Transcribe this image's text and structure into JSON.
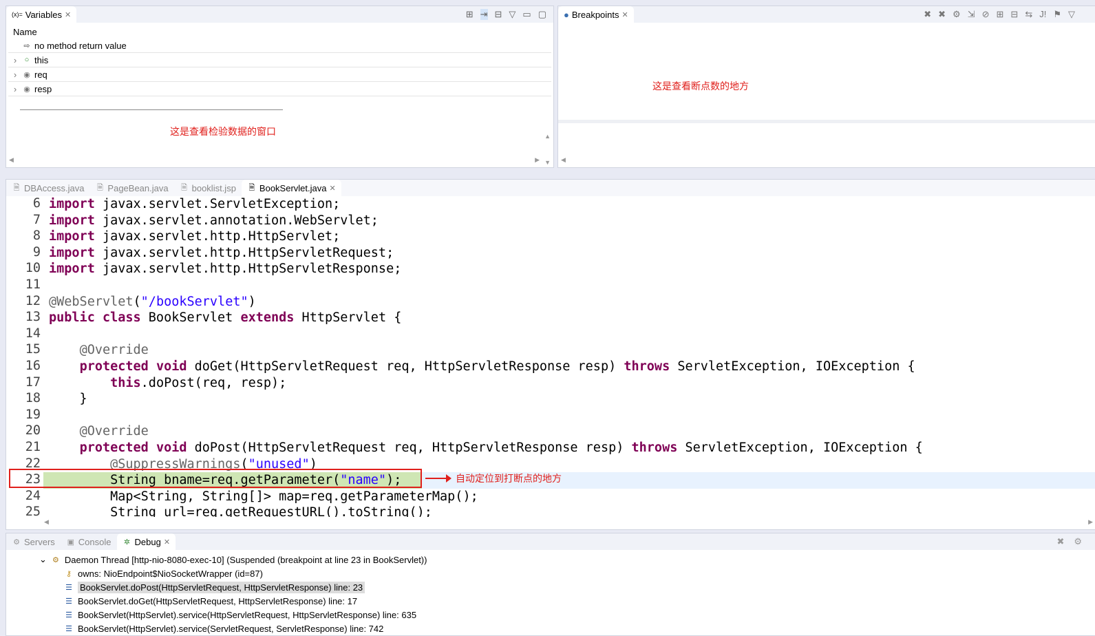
{
  "variables": {
    "tab": "Variables",
    "tab_icon": "(x)=",
    "column": "Name",
    "rows": [
      {
        "name": "no method return value",
        "icon": "return-icon",
        "expandable": false
      },
      {
        "name": "this",
        "icon": "field-icon",
        "expandable": true
      },
      {
        "name": "req",
        "icon": "local-icon",
        "expandable": true
      },
      {
        "name": "resp",
        "icon": "local-icon",
        "expandable": true
      }
    ],
    "note": "这是查看检验数据的窗口"
  },
  "breakpoints": {
    "tab": "Breakpoints",
    "note": "这是查看断点数的地方"
  },
  "editor": {
    "tabs": [
      {
        "label": "DBAccess.java"
      },
      {
        "label": "PageBean.java"
      },
      {
        "label": "booklist.jsp"
      },
      {
        "label": "BookServlet.java",
        "active": true
      }
    ],
    "lines": [
      {
        "n": "6",
        "html": "<span class='kw'>import</span> javax.servlet.ServletException;"
      },
      {
        "n": "7",
        "html": "<span class='kw'>import</span> javax.servlet.annotation.WebServlet;"
      },
      {
        "n": "8",
        "html": "<span class='kw'>import</span> javax.servlet.http.HttpServlet;"
      },
      {
        "n": "9",
        "html": "<span class='kw'>import</span> javax.servlet.http.HttpServletRequest;"
      },
      {
        "n": "10",
        "html": "<span class='kw'>import</span> javax.servlet.http.HttpServletResponse;"
      },
      {
        "n": "11",
        "html": ""
      },
      {
        "n": "12",
        "html": "<span class='an'>@WebServlet</span>(<span class='st'>\"/bookServlet\"</span>)"
      },
      {
        "n": "13",
        "html": "<span class='kw'>public class</span> BookServlet <span class='kw'>extends</span> HttpServlet {"
      },
      {
        "n": "14",
        "html": ""
      },
      {
        "n": "15",
        "html": "    <span class='an'>@Override</span>"
      },
      {
        "n": "16",
        "html": "    <span class='kw'>protected void</span> doGet(HttpServletRequest req, HttpServletResponse resp) <span class='kw'>throws</span> ServletException, IOException {"
      },
      {
        "n": "17",
        "html": "        <span class='kw'>this</span>.doPost(req, resp);"
      },
      {
        "n": "18",
        "html": "    }"
      },
      {
        "n": "19",
        "html": ""
      },
      {
        "n": "20",
        "html": "    <span class='an'>@Override</span>"
      },
      {
        "n": "21",
        "html": "    <span class='kw'>protected void</span> doPost(HttpServletRequest req, HttpServletResponse resp) <span class='kw'>throws</span> ServletException, IOException {"
      },
      {
        "n": "22",
        "html": "        <span class='an'>@SuppressWarnings</span>(<span class='st'>\"unused\"</span>)"
      },
      {
        "n": "23",
        "html": "        String bname=req.getParameter(<span class='st'>\"name\"</span>);"
      },
      {
        "n": "24",
        "html": "        Map&lt;String, String[]&gt; map=req.getParameterMap();"
      },
      {
        "n": "25",
        "html": "        String url=req.getRequestURL().toString();"
      }
    ],
    "current_line": "23",
    "note": "自动定位到打断点的地方"
  },
  "bottom": {
    "tabs": [
      {
        "label": "Servers"
      },
      {
        "label": "Console"
      },
      {
        "label": "Debug",
        "active": true
      }
    ],
    "thread": "Daemon Thread [http-nio-8080-exec-10] (Suspended (breakpoint at line 23 in BookServlet))",
    "owns": "owns: NioEndpoint$NioSocketWrapper  (id=87)",
    "frames": [
      "BookServlet.doPost(HttpServletRequest, HttpServletResponse) line: 23",
      "BookServlet.doGet(HttpServletRequest, HttpServletResponse) line: 17",
      "BookServlet(HttpServlet).service(HttpServletRequest, HttpServletResponse) line: 635",
      "BookServlet(HttpServlet).service(ServletRequest, ServletResponse) line: 742"
    ]
  },
  "colors": {
    "highlight_line": "#cfe6b4",
    "annotation_red": "#e0201c",
    "keyword": "#7f0055",
    "string": "#2a00ff"
  }
}
